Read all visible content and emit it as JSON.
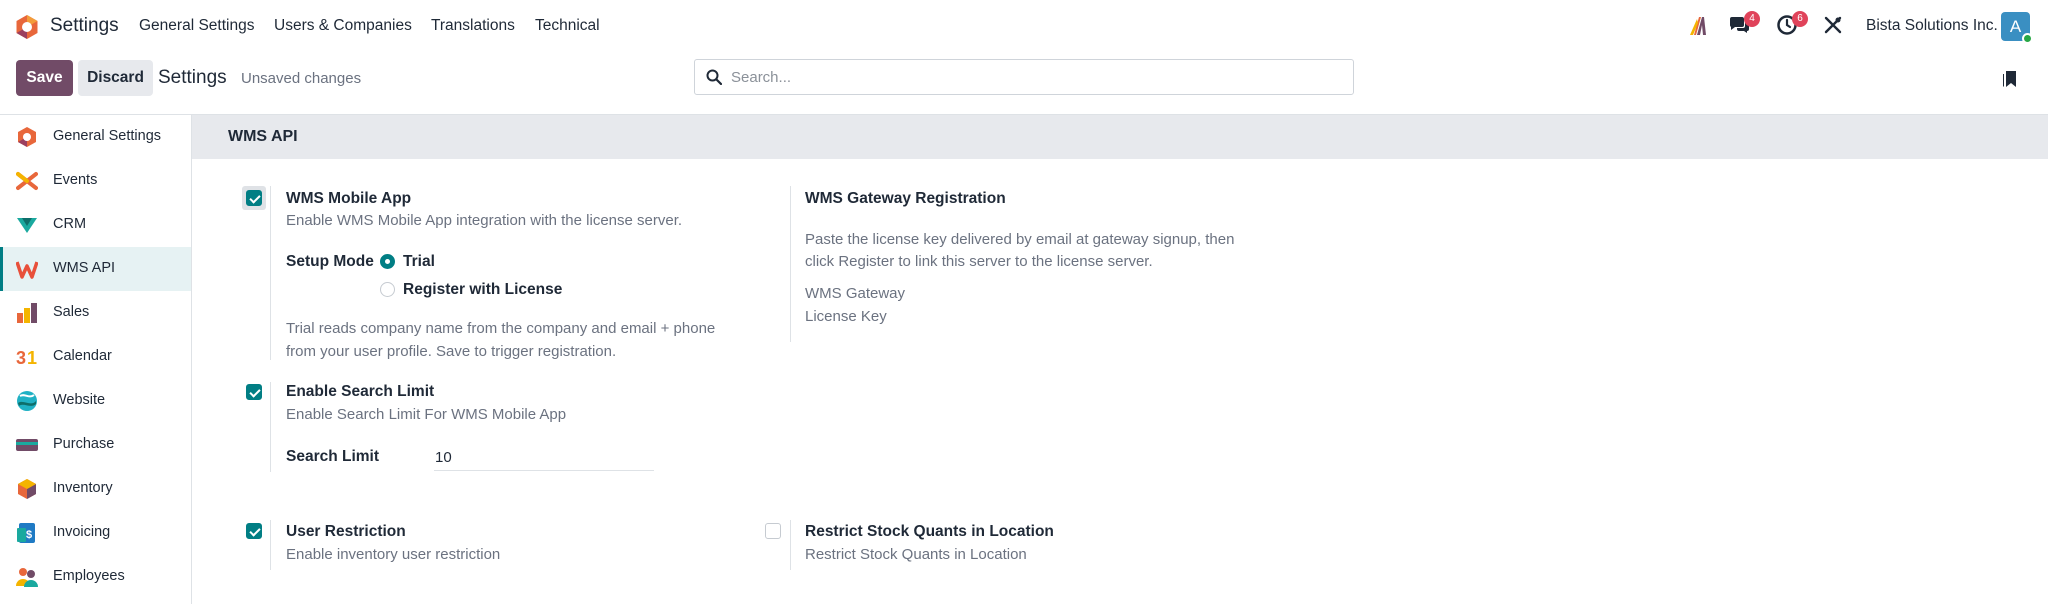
{
  "navbar": {
    "app_name": "Settings",
    "menu": [
      "General Settings",
      "Users & Companies",
      "Translations",
      "Technical"
    ],
    "messages_count": "4",
    "activities_count": "6",
    "company": "Bista Solutions Inc.",
    "avatar_initial": "A",
    "brand_color": "#714b67"
  },
  "control_panel": {
    "save_label": "Save",
    "discard_label": "Discard",
    "title": "Settings",
    "status": "Unsaved changes",
    "search_placeholder": "Search..."
  },
  "sidebar": {
    "items": [
      {
        "label": "General Settings",
        "icon": "general-settings-icon"
      },
      {
        "label": "Events",
        "icon": "events-icon"
      },
      {
        "label": "CRM",
        "icon": "crm-icon"
      },
      {
        "label": "WMS API",
        "icon": "wms-api-icon",
        "active": true
      },
      {
        "label": "Sales",
        "icon": "sales-icon"
      },
      {
        "label": "Calendar",
        "icon": "calendar-icon"
      },
      {
        "label": "Website",
        "icon": "website-icon"
      },
      {
        "label": "Purchase",
        "icon": "purchase-icon"
      },
      {
        "label": "Inventory",
        "icon": "inventory-icon"
      },
      {
        "label": "Invoicing",
        "icon": "invoicing-icon"
      },
      {
        "label": "Employees",
        "icon": "employees-icon"
      }
    ]
  },
  "main": {
    "section_title": "WMS API",
    "wms_mobile_app": {
      "title": "WMS Mobile App",
      "description": "Enable WMS Mobile App integration with the license server.",
      "checked": true,
      "setup_mode_label": "Setup Mode",
      "options": [
        "Trial",
        "Register with License"
      ],
      "selected": "Trial",
      "note_line1": "Trial reads company name from the company and email + phone",
      "note_line2": "from your user profile. Save to trigger registration."
    },
    "gateway": {
      "title": "WMS Gateway Registration",
      "desc_line1": "Paste the license key delivered by email at gateway signup, then",
      "desc_line2": "click Register to link this server to the license server.",
      "field_line1": "WMS Gateway",
      "field_line2": "License Key"
    },
    "search_limit": {
      "title": "Enable Search Limit",
      "description": "Enable Search Limit For WMS Mobile App",
      "checked": true,
      "field_label": "Search Limit",
      "value": "10"
    },
    "user_restriction": {
      "title": "User Restriction",
      "description": "Enable inventory user restriction",
      "checked": true
    },
    "restrict_quants": {
      "title": "Restrict Stock Quants in Location",
      "description": "Restrict Stock Quants in Location",
      "checked": false
    }
  }
}
